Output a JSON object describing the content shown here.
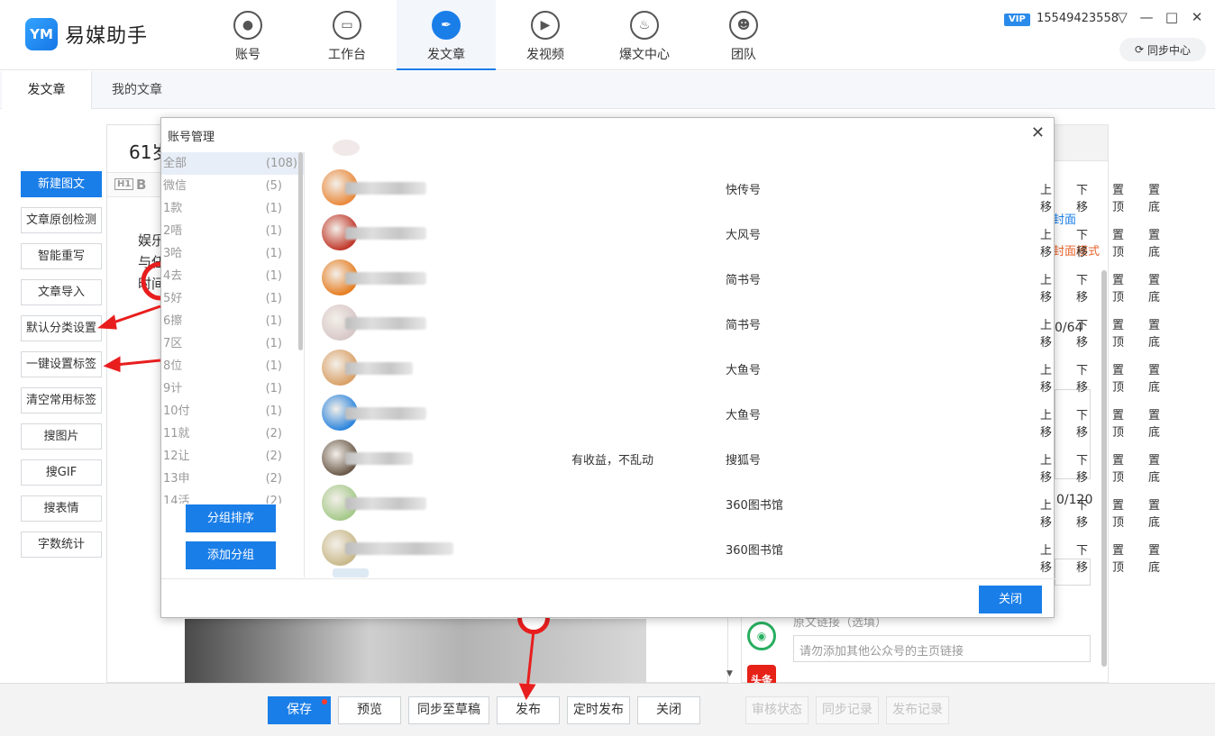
{
  "app": {
    "logo_mark": "YM",
    "name": "易媒助手"
  },
  "nav": [
    {
      "label": "账号",
      "icon": "user-icon",
      "active": false
    },
    {
      "label": "工作台",
      "icon": "monitor-icon",
      "active": false
    },
    {
      "label": "发文章",
      "icon": "feather-icon",
      "active": true
    },
    {
      "label": "发视频",
      "icon": "play-icon",
      "active": false
    },
    {
      "label": "爆文中心",
      "icon": "fire-icon",
      "active": false
    },
    {
      "label": "团队",
      "icon": "team-icon",
      "active": false
    }
  ],
  "user": {
    "vip": "VIP",
    "phone": "15549423558",
    "sync_center": "同步中心"
  },
  "subtabs": {
    "active": "发文章",
    "other": "我的文章"
  },
  "leftbar": [
    "新建图文",
    "文章原创检测",
    "智能重写",
    "文章导入",
    "默认分类设置",
    "一键设置标签",
    "清空常用标签",
    "搜图片",
    "搜GIF",
    "搜表情",
    "字数统计"
  ],
  "editor": {
    "title_fragment": "61岁",
    "body_lines": [
      "娱乐",
      "与任",
      "时间"
    ]
  },
  "right_panel": {
    "cover_link": "封面",
    "cover_mode": "封面模式",
    "title_count": "0/64",
    "summary_count": "0/120",
    "source_link_label": "原文链接（选填）",
    "homepage_placeholder": "请勿添加其他公众号的主页链接",
    "toutiao_label": "头条"
  },
  "bottom": {
    "save": "保存",
    "preview": "预览",
    "sync_draft": "同步至草稿",
    "publish": "发布",
    "scheduled": "定时发布",
    "close": "关闭",
    "review_status": "审核状态",
    "sync_log": "同步记录",
    "publish_log": "发布记录"
  },
  "modal": {
    "title": "账号管理",
    "groups": [
      {
        "name": "全部",
        "count": "(108)"
      },
      {
        "name": "微信",
        "count": "(5)"
      },
      {
        "name": "1款",
        "count": "(1)"
      },
      {
        "name": "2唔",
        "count": "(1)"
      },
      {
        "name": "3哈",
        "count": "(1)"
      },
      {
        "name": "4去",
        "count": "(1)"
      },
      {
        "name": "5好",
        "count": "(1)"
      },
      {
        "name": "6擦",
        "count": "(1)"
      },
      {
        "name": "7区",
        "count": "(1)"
      },
      {
        "name": "8位",
        "count": "(1)"
      },
      {
        "name": "9计",
        "count": "(1)"
      },
      {
        "name": "10付",
        "count": "(1)"
      },
      {
        "name": "11就",
        "count": "(2)"
      },
      {
        "name": "12让",
        "count": "(2)"
      },
      {
        "name": "13申",
        "count": "(2)"
      },
      {
        "name": "14活",
        "count": "(2)"
      }
    ],
    "sort_groups": "分组排序",
    "add_group": "添加分组",
    "close": "关闭",
    "actions": [
      "上移",
      "下移",
      "置顶",
      "置底"
    ],
    "accounts": [
      {
        "platform": "快传号",
        "note": "",
        "avatar_color": "#e98a3c"
      },
      {
        "platform": "大风号",
        "note": "",
        "avatar_color": "#c0392b"
      },
      {
        "platform": "简书号",
        "note": "",
        "avatar_color": "#e67e22"
      },
      {
        "platform": "简书号",
        "note": "",
        "avatar_color": "#d8c8c8"
      },
      {
        "platform": "大鱼号",
        "note": "",
        "avatar_color": "#d9a066"
      },
      {
        "platform": "大鱼号",
        "note": "",
        "avatar_color": "#2e86de"
      },
      {
        "platform": "搜狐号",
        "note": "有收益，不乱动",
        "avatar_color": "#6b5a4a"
      },
      {
        "platform": "360图书馆",
        "note": "",
        "avatar_color": "#a5c98a"
      },
      {
        "platform": "360图书馆",
        "note": "",
        "avatar_color": "#c9b98a"
      }
    ]
  }
}
